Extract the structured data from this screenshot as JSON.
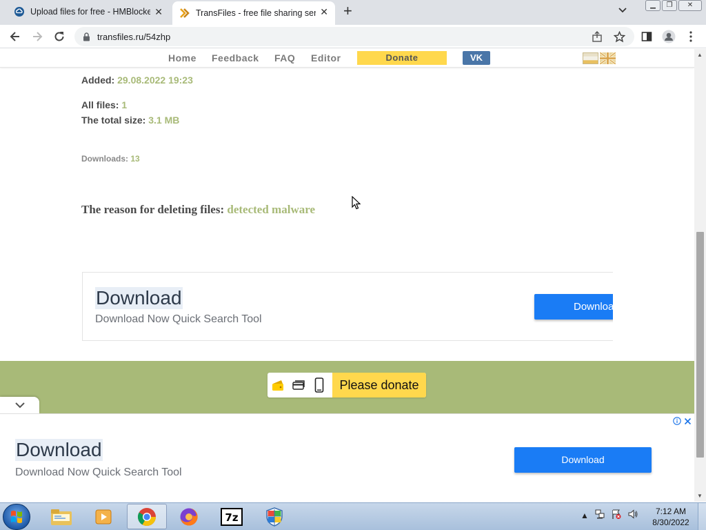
{
  "browser": {
    "tabs": [
      {
        "title": "Upload files for free - HMBlocker",
        "favicon": "hmb-cloud-icon",
        "active": false
      },
      {
        "title": "TransFiles - free file sharing servi",
        "favicon": "transfiles-chevron-icon",
        "active": true
      }
    ],
    "new_tab": "+",
    "url": "transfiles.ru/54zhp"
  },
  "site_nav": {
    "items": [
      "Home",
      "Feedback",
      "FAQ",
      "Editor"
    ],
    "donate": "Donate",
    "vk": "VK"
  },
  "file_info": {
    "added_label": "Added:",
    "added_value": "29.08.2022 19:23",
    "all_files_label": "All files:",
    "all_files_value": "1",
    "total_size_label": "The total size:",
    "total_size_value": "3.1 MB",
    "downloads_label": "Downloads:",
    "downloads_value": "13",
    "reason_label": "The reason for deleting files:",
    "reason_value": "detected malware"
  },
  "ad_inline": {
    "title": "Download",
    "subtitle": "Download Now Quick Search Tool",
    "button": "Downloa"
  },
  "donate_bar": {
    "label": "Please donate"
  },
  "ad_bottom": {
    "title": "Download",
    "subtitle": "Download Now Quick Search Tool",
    "button": "Download"
  },
  "taskbar": {
    "apps": [
      "explorer-icon",
      "media-player-icon",
      "chrome-icon",
      "firefox-icon",
      "7zip-icon",
      "security-shield-icon"
    ],
    "time": "7:12 AM",
    "date": "8/30/2022"
  },
  "colors": {
    "accent_green": "#a8ba78",
    "donate_yellow": "#ffd84d",
    "vk_blue": "#4a76a8",
    "ad_button_blue": "#1a7cf5"
  }
}
